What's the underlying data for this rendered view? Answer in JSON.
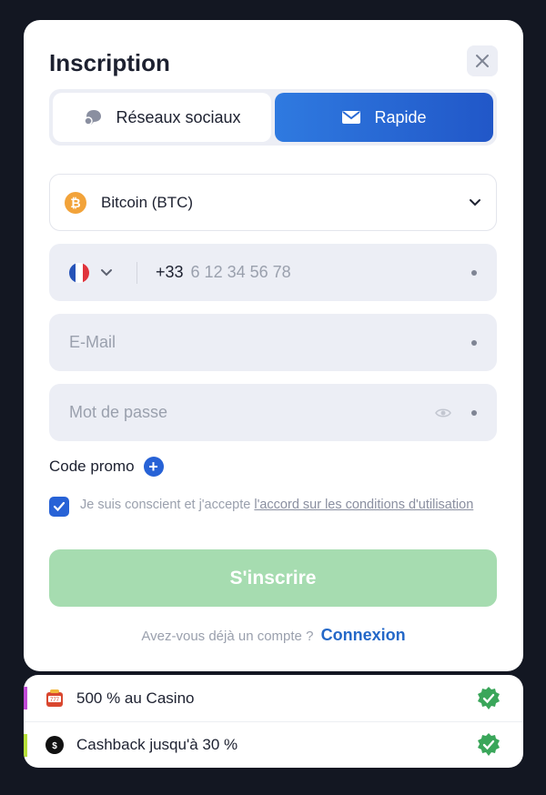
{
  "modal": {
    "title": "Inscription",
    "close_icon": "close-icon"
  },
  "tabs": [
    {
      "label": "Réseaux sociaux",
      "icon": "chat-bubble-icon",
      "active": false
    },
    {
      "label": "Rapide",
      "icon": "envelope-icon",
      "active": true
    }
  ],
  "currency": {
    "selected": "Bitcoin (BTC)",
    "icon": "bitcoin-icon",
    "icon_color": "#f2a33a"
  },
  "phone": {
    "country_flag": "france-flag-icon",
    "prefix": "+33",
    "placeholder": "6 12 34 56 78"
  },
  "email": {
    "placeholder": "E-Mail"
  },
  "password": {
    "placeholder": "Mot de passe",
    "toggle_icon": "eye-icon"
  },
  "promo": {
    "label": "Code promo"
  },
  "terms": {
    "checked": true,
    "text": "Je suis conscient et j'accepte ",
    "link": "l'accord sur les conditions d'utilisation"
  },
  "submit": {
    "label": "S'inscrire"
  },
  "login": {
    "prompt": "Avez-vous déjà un compte ?",
    "link": "Connexion"
  },
  "bonuses": [
    {
      "label": "500 % au Casino",
      "icon": "slot-machine-icon",
      "accent": "#c14ad6"
    },
    {
      "label": "Cashback jusqu'à 30 %",
      "icon": "cashback-coin-icon",
      "accent": "#b6e03a"
    }
  ],
  "colors": {
    "accent_blue": "#2762d6",
    "submit_green": "#a6dcb0",
    "badge_green": "#3aa65a"
  }
}
